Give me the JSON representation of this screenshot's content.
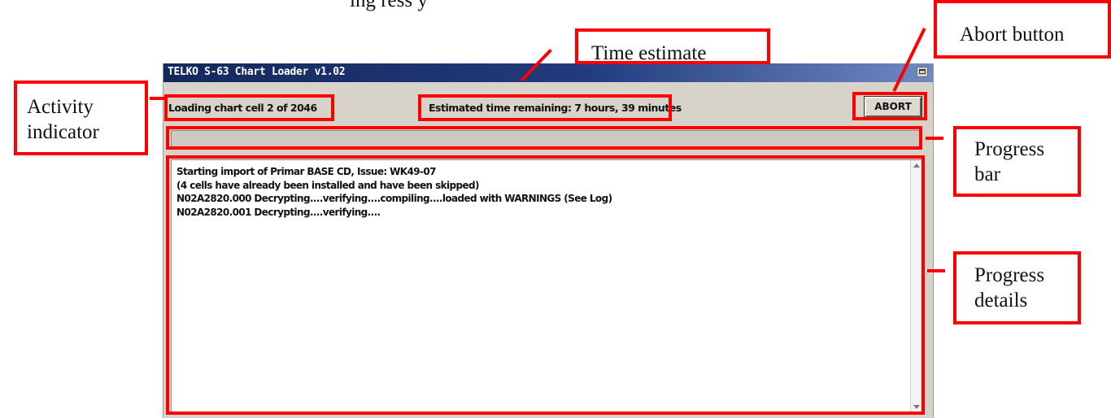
{
  "page": {
    "intro_fragment": "ing                  ress                        y"
  },
  "window": {
    "title": "TELKO S-63 Chart Loader v1.02",
    "activity_text": "Loading chart cell 2 of 2046",
    "estimate_text": "Estimated time remaining: 7 hours, 39 minutes",
    "abort_label": "ABORT",
    "progress_fraction": 0.0,
    "details_lines": [
      "Starting import of Primar BASE CD, Issue: WK49-07",
      "(4 cells have already been installed and have been skipped)",
      "N02A2820.000 Decrypting....verifying....compiling....loaded with WARNINGS (See Log)",
      "N02A2820.001 Decrypting....verifying...."
    ]
  },
  "annotations": {
    "time_estimate": "Time estimate",
    "abort_button": "Abort button",
    "activity_indicator": [
      "Activity",
      "indicator"
    ],
    "progress_bar": [
      "Progress",
      "bar"
    ],
    "progress_details": [
      "Progress",
      "details"
    ]
  },
  "colors": {
    "annotation": "#ff0000",
    "titlebar_start": "#14285c",
    "titlebar_end": "#6f88c6",
    "window_bg": "#d7d3cb"
  },
  "icons": [
    "restore-window-icon",
    "scroll-up-arrow-icon",
    "scroll-down-arrow-icon"
  ]
}
